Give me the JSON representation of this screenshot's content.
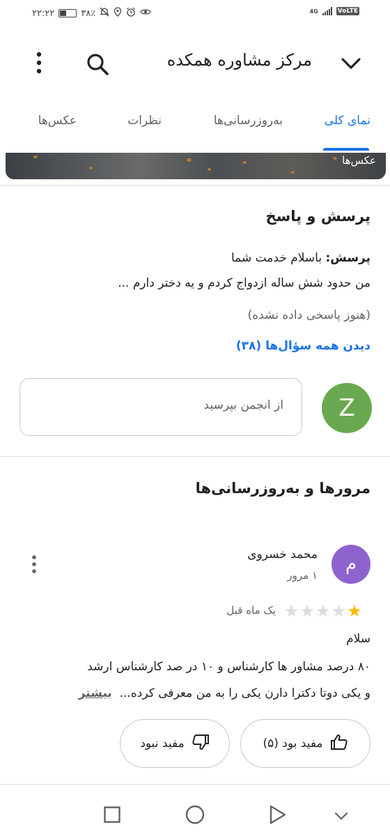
{
  "status_bar": {
    "time": "۲۲:۲۲",
    "battery_percent": "۳۸٪",
    "network": "4G",
    "volte": "VoLTE"
  },
  "app_bar": {
    "title": "مرکز مشاوره همکده"
  },
  "tabs": [
    {
      "label": "نمای کلی",
      "active": true
    },
    {
      "label": "به‌روزرسانی‌ها",
      "active": false
    },
    {
      "label": "نظرات",
      "active": false
    },
    {
      "label": "عکس‌ها",
      "active": false
    }
  ],
  "photo_strip": {
    "label": "عکس‌ها"
  },
  "qa": {
    "title": "پرسش و پاسخ",
    "question_prefix": "پرسش:",
    "question_text": " باسلام خدمت شما",
    "question_line2": "من حدود شش ساله ازدواج کردم و یه دختر دارم ...",
    "no_answer": "(هنوز پاسخی داده نشده)",
    "see_all": "دیدن همه سؤال‌ها (۳۸)",
    "ask_placeholder": "از انجمن بپرسید",
    "user_initial": "Z",
    "user_avatar_color": "#6aa84f"
  },
  "reviews": {
    "title": "مرورها و به‌روزرسانی‌ها",
    "item": {
      "author": "محمد خسروی",
      "author_initial": "م",
      "avatar_color": "#8e63ce",
      "meta": "۱ مرور",
      "rating": 1,
      "rating_max": 5,
      "time": "یک ماه قبل",
      "greeting": "سلام",
      "body_line1": "۸۰ درصد  مشاور ها کارشناس و ۱۰ در صد کارشناس ارشد",
      "body_line2": "و یکی دوتا دکترا دارن یکی را به من معرفی کرده...",
      "more": "بیشتر",
      "helpful": "مفید بود (۵)",
      "not_helpful": "مفید نبود"
    }
  },
  "colors": {
    "accent": "#1a73e8",
    "star": "#fbbc04"
  }
}
